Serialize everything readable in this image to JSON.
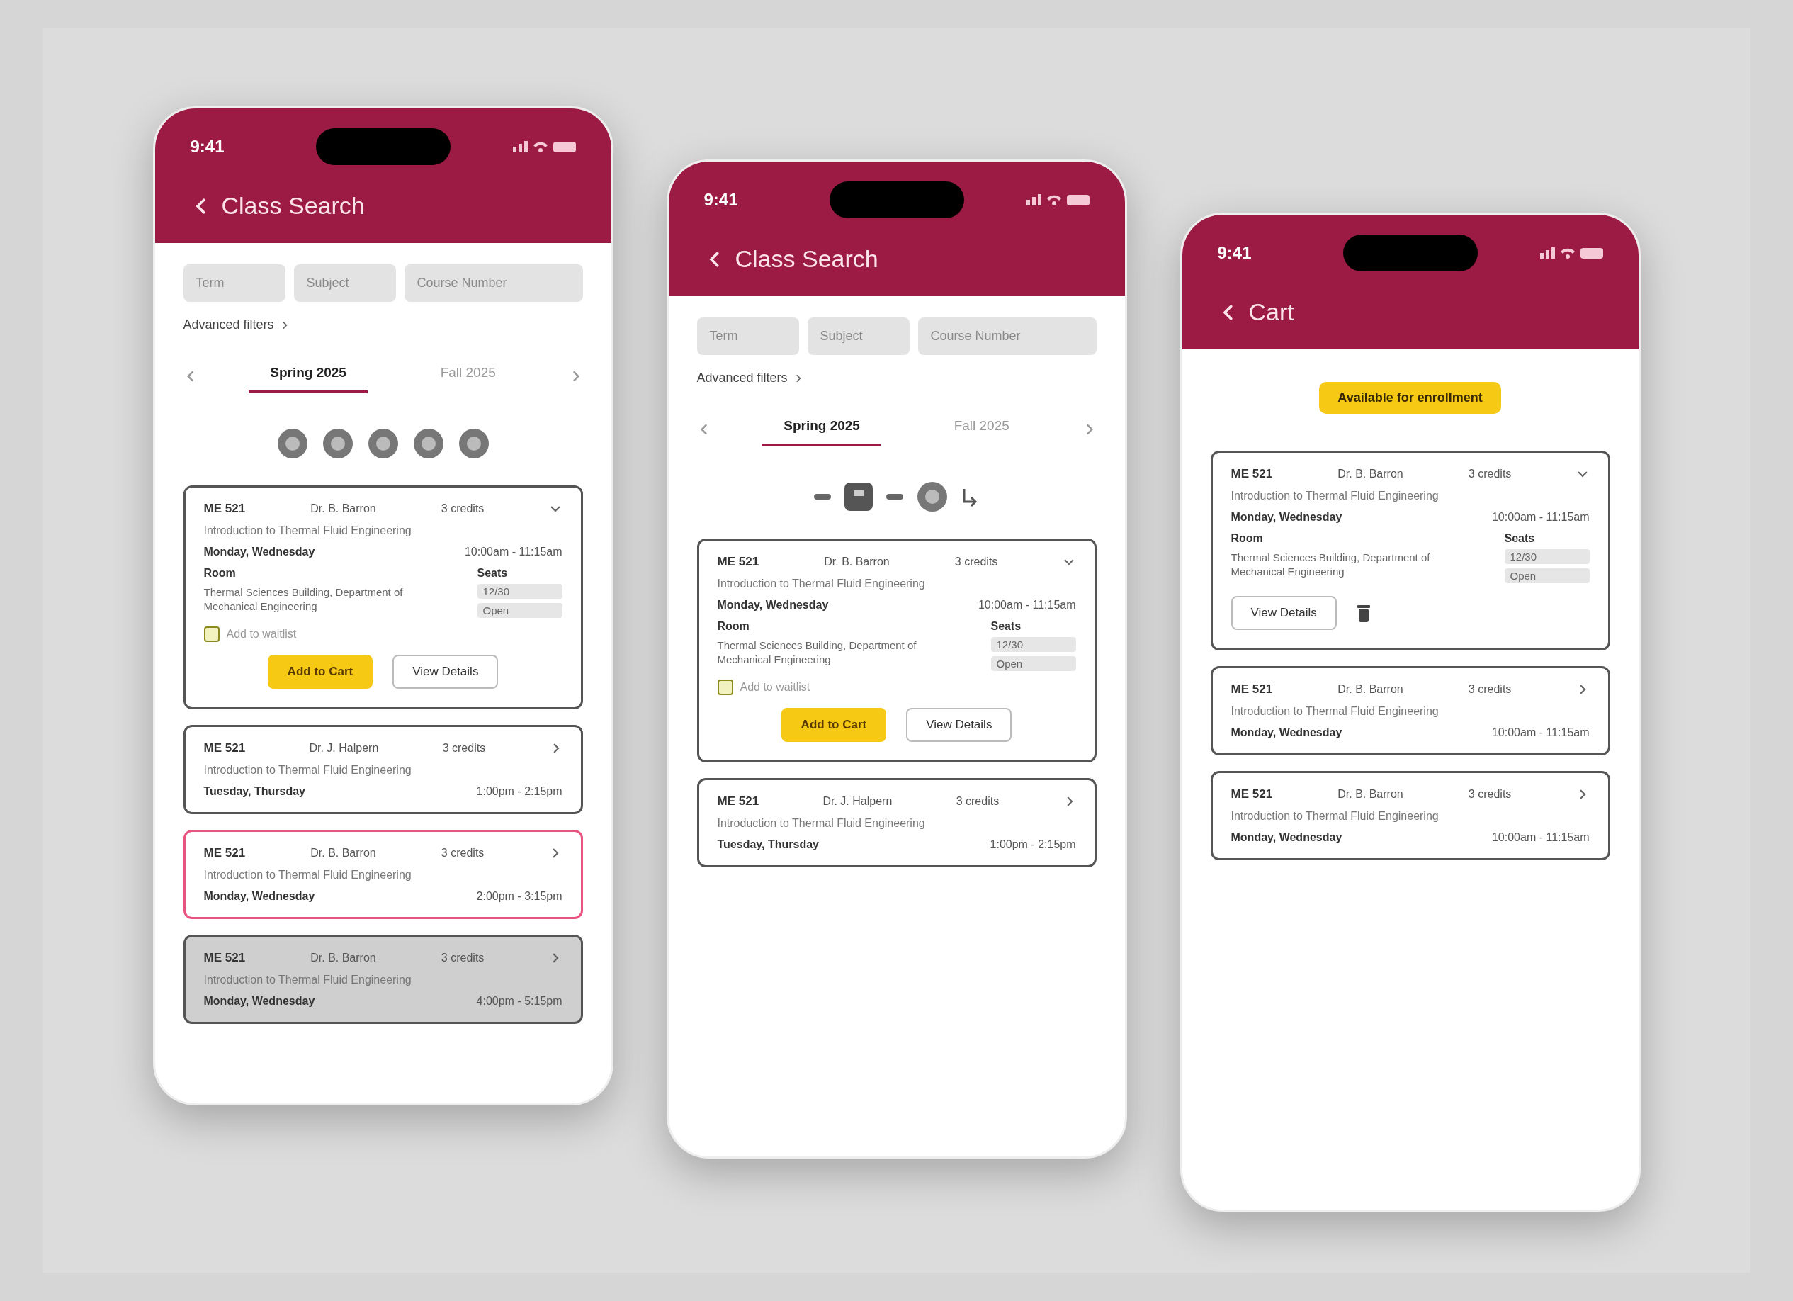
{
  "phones": [
    {
      "kind": "search",
      "time": "9:41",
      "title": "Class Search",
      "filters": [
        "Term",
        "Subject",
        "Course Number"
      ],
      "advanced_filters": "Advanced filters",
      "terms": [
        {
          "label": "Spring 2025",
          "selected": true
        },
        {
          "label": "Fall 2025",
          "selected": false
        }
      ],
      "toolbar": [
        {
          "kind": "round"
        },
        {
          "kind": "round"
        },
        {
          "kind": "round"
        },
        {
          "kind": "round"
        },
        {
          "kind": "round"
        }
      ],
      "cards": [
        {
          "code": "ME 521",
          "instructor": "Dr. B. Barron",
          "credits": "3 credits",
          "title": "Introduction to Thermal Fluid Engineering",
          "days": "Monday, Wednesday",
          "time": "10:00am - 11:15am",
          "expanded": true,
          "selected": false,
          "disabled": false,
          "room_label": "Room",
          "seats_label": "Seats",
          "room": "Thermal Sciences Building, Department of Mechanical Engineering",
          "seats": [
            "12/30",
            "Open"
          ],
          "waitlist": {
            "label": "Add to waitlist",
            "checked": false
          },
          "buttons": [
            {
              "label": "Add to Cart",
              "kind": "primary"
            },
            {
              "label": "View Details",
              "kind": "secondary"
            }
          ]
        },
        {
          "code": "ME 521",
          "instructor": "Dr. J. Halpern",
          "credits": "3 credits",
          "title": "Introduction to Thermal Fluid Engineering",
          "days": "Tuesday, Thursday",
          "time": "1:00pm - 2:15pm",
          "expanded": false,
          "selected": false,
          "disabled": false
        },
        {
          "code": "ME 521",
          "instructor": "Dr. B. Barron",
          "credits": "3 credits",
          "title": "Introduction to Thermal Fluid Engineering",
          "days": "Monday, Wednesday",
          "time": "2:00pm - 3:15pm",
          "expanded": false,
          "selected": true,
          "disabled": false
        },
        {
          "code": "ME 521",
          "instructor": "Dr. B. Barron",
          "credits": "3 credits",
          "title": "Introduction to Thermal Fluid Engineering",
          "days": "Monday, Wednesday",
          "time": "4:00pm - 5:15pm",
          "expanded": false,
          "selected": false,
          "disabled": true
        }
      ]
    },
    {
      "kind": "search",
      "time": "9:41",
      "title": "Class Search",
      "filters": [
        "Term",
        "Subject",
        "Course Number"
      ],
      "advanced_filters": "Advanced filters",
      "terms": [
        {
          "label": "Spring 2025",
          "selected": true
        },
        {
          "label": "Fall 2025",
          "selected": false
        }
      ],
      "toolbar": [
        {
          "kind": "dash"
        },
        {
          "kind": "square"
        },
        {
          "kind": "dash"
        },
        {
          "kind": "round"
        },
        {
          "kind": "arrow"
        }
      ],
      "cards": [
        {
          "code": "ME 521",
          "instructor": "Dr. B. Barron",
          "credits": "3 credits",
          "title": "Introduction to Thermal Fluid Engineering",
          "days": "Monday, Wednesday",
          "time": "10:00am - 11:15am",
          "expanded": true,
          "selected": false,
          "disabled": false,
          "room_label": "Room",
          "seats_label": "Seats",
          "room": "Thermal Sciences Building, Department of Mechanical Engineering",
          "seats": [
            "12/30",
            "Open"
          ],
          "waitlist": {
            "label": "Add to waitlist",
            "checked": false
          },
          "buttons": [
            {
              "label": "Add to Cart",
              "kind": "primary"
            },
            {
              "label": "View Details",
              "kind": "secondary"
            }
          ]
        },
        {
          "code": "ME 521",
          "instructor": "Dr. J. Halpern",
          "credits": "3 credits",
          "title": "Introduction to Thermal Fluid Engineering",
          "days": "Tuesday, Thursday",
          "time": "1:00pm - 2:15pm",
          "expanded": false,
          "selected": false,
          "disabled": false
        }
      ]
    },
    {
      "kind": "cart",
      "time": "9:41",
      "title": "Cart",
      "badge": "Available for enrollment",
      "cards": [
        {
          "code": "ME 521",
          "instructor": "Dr. B. Barron",
          "credits": "3 credits",
          "title": "Introduction to Thermal Fluid Engineering",
          "days": "Monday, Wednesday",
          "time": "10:00am - 11:15am",
          "expanded": true,
          "selected": false,
          "disabled": false,
          "room_label": "Room",
          "seats_label": "Seats",
          "room": "Thermal Sciences Building, Department of Mechanical Engineering",
          "seats": [
            "12/30",
            "Open"
          ],
          "removable": true,
          "buttons": [
            {
              "label": "View Details",
              "kind": "secondary"
            }
          ]
        },
        {
          "code": "ME 521",
          "instructor": "Dr. B. Barron",
          "credits": "3 credits",
          "title": "Introduction to Thermal Fluid Engineering",
          "days": "Monday, Wednesday",
          "time": "10:00am - 11:15am",
          "expanded": false,
          "selected": false,
          "disabled": false
        },
        {
          "code": "ME 521",
          "instructor": "Dr. B. Barron",
          "credits": "3 credits",
          "title": "Introduction to Thermal Fluid Engineering",
          "days": "Monday, Wednesday",
          "time": "10:00am - 11:15am",
          "expanded": false,
          "selected": false,
          "disabled": false
        }
      ]
    }
  ]
}
